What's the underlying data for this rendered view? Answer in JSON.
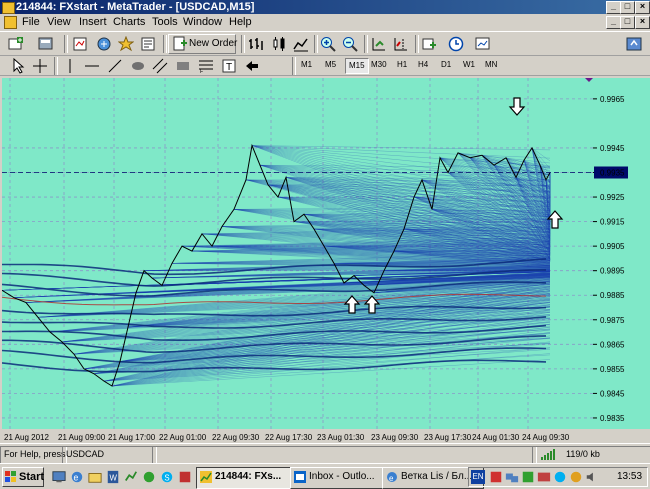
{
  "window": {
    "title": "214844: FXstart - MetaTrader - [USDCAD,M15]",
    "controls": [
      "_",
      "□",
      "×"
    ],
    "mdi_controls": [
      "_",
      "□",
      "×"
    ]
  },
  "menu": [
    "File",
    "View",
    "Insert",
    "Charts",
    "Tools",
    "Window",
    "Help"
  ],
  "toolbar": {
    "new_order_label": "New Order",
    "timeframes": [
      "M1",
      "M5",
      "M15",
      "M30",
      "H1",
      "H4",
      "D1",
      "W1",
      "MN"
    ],
    "active_timeframe": "M15"
  },
  "chart": {
    "symbol": "USDCAD",
    "timeframe": "M15",
    "background_color": "#7fe8c8",
    "line_color": "#1a3fb0",
    "current_price": "0.9935",
    "price_ticks": [
      "0.9965",
      "0.9945",
      "0.9935",
      "0.9925",
      "0.9915",
      "0.9905",
      "0.9895",
      "0.9885",
      "0.9875",
      "0.9865",
      "0.9855",
      "0.9845",
      "0.9835"
    ],
    "time_ticks": [
      "21 Aug 2012",
      "21 Aug 09:00",
      "21 Aug 17:00",
      "22 Aug 01:00",
      "22 Aug 09:30",
      "22 Aug 17:30",
      "23 Aug 01:30",
      "23 Aug 09:30",
      "23 Aug 17:30",
      "24 Aug 01:30",
      "24 Aug 09:30"
    ],
    "annotations": [
      "down-arrow",
      "up-arrow",
      "up-arrow",
      "up-arrow"
    ]
  },
  "status": {
    "help_text": "For Help, press",
    "symbol": "USDCAD",
    "traffic": "119/0 kb"
  },
  "taskbar": {
    "start_label": "Start",
    "tasks": [
      "214844: FXs...",
      "Inbox - Outlo...",
      "Ветка Lis / Бл..."
    ],
    "tray_lang": "EN",
    "clock": "13:53"
  }
}
